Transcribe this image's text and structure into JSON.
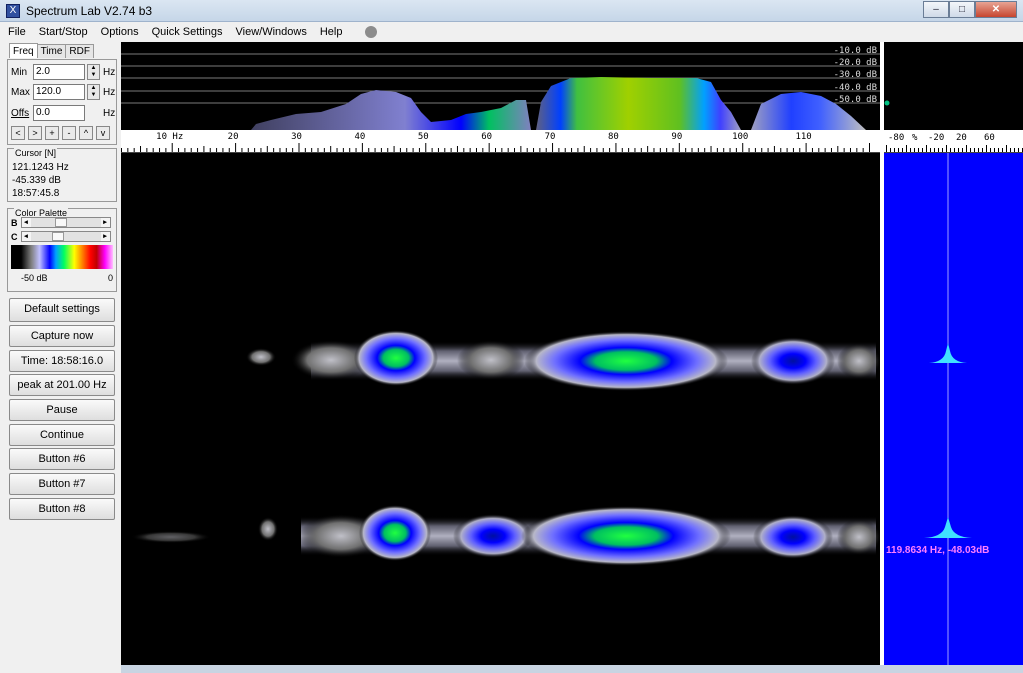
{
  "window": {
    "title": "Spectrum Lab V2.74 b3",
    "app_icon": "X"
  },
  "window_controls": {
    "minimize": "–",
    "maximize": "□",
    "close": "✕"
  },
  "menu": [
    {
      "label": "File"
    },
    {
      "label": "Start/Stop"
    },
    {
      "label": "Options"
    },
    {
      "label": "Quick Settings"
    },
    {
      "label": "View/Windows"
    },
    {
      "label": "Help"
    }
  ],
  "tabs": [
    {
      "label": "Freq"
    },
    {
      "label": "Time"
    },
    {
      "label": "RDF"
    }
  ],
  "freq": {
    "min_label": "Min",
    "min_value": "2.0",
    "min_unit": "Hz",
    "max_label": "Max",
    "max_value": "120.0",
    "max_unit": "Hz",
    "offs_label": "Offs",
    "offs_value": "0.0",
    "offs_unit": "Hz",
    "nav": [
      "<",
      ">",
      "+",
      "-",
      "^",
      "v"
    ]
  },
  "cursor": {
    "title": "Cursor [N]",
    "freq": "121.1243 Hz",
    "level": "-45.339 dB",
    "time": "18:57:45.8"
  },
  "palette": {
    "title": "Color Palette",
    "b_label": "B",
    "c_label": "C",
    "b_value": 0.4,
    "c_value": 0.35,
    "min_label": "-50 dB",
    "max_label": "0"
  },
  "buttons": [
    {
      "label": "Default settings"
    },
    {
      "label": "Capture now"
    },
    {
      "label": "Time:  18:58:16.0"
    },
    {
      "label": "peak at 201.00 Hz"
    },
    {
      "label": "Pause"
    },
    {
      "label": "Continue"
    },
    {
      "label": "Button #6"
    },
    {
      "label": "Button #7"
    },
    {
      "label": "Button #8"
    }
  ],
  "db_scale": [
    "-10.0 dB",
    "-20.0 dB",
    "-30.0 dB",
    "-40.0 dB",
    "-50.0 dB"
  ],
  "freq_axis": {
    "min": 2,
    "max": 120,
    "ticks": [
      {
        "v": 10,
        "label": "10 Hz"
      },
      {
        "v": 20,
        "label": "20"
      },
      {
        "v": 30,
        "label": "30"
      },
      {
        "v": 40,
        "label": "40"
      },
      {
        "v": 50,
        "label": "50"
      },
      {
        "v": 60,
        "label": "60"
      },
      {
        "v": 70,
        "label": "70"
      },
      {
        "v": 80,
        "label": "80"
      },
      {
        "v": 90,
        "label": "90"
      },
      {
        "v": 100,
        "label": "100"
      },
      {
        "v": 110,
        "label": "110"
      }
    ]
  },
  "right_axis": [
    "-80",
    "%",
    "-20",
    "20",
    "60"
  ],
  "marker": {
    "readout": "119.8634 Hz, -48.03dB"
  },
  "colors": {
    "window_bg": "#f0f0f0",
    "readout": "#ff7fff",
    "right_bg": "#0000ff"
  }
}
